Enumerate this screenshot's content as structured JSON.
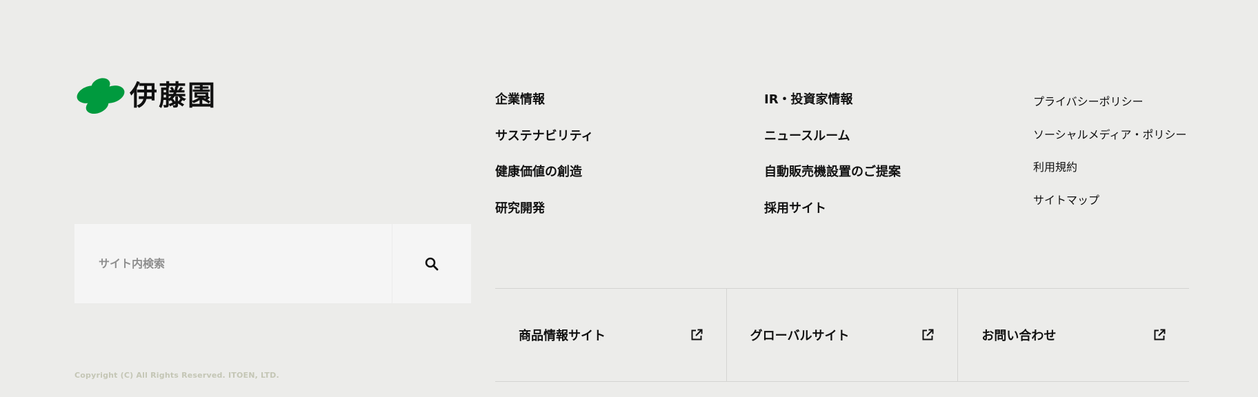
{
  "brand": {
    "name": "伊藤園",
    "logo_color": "#009a3e"
  },
  "search": {
    "placeholder": "サイト内検索",
    "icon": "search-icon"
  },
  "nav": {
    "col1": [
      "企業情報",
      "サステナビリティ",
      "健康価値の創造",
      "研究開発"
    ],
    "col2": [
      "IR・投資家情報",
      "ニュースルーム",
      "自動販売機設置のご提案",
      "採用サイト"
    ],
    "col3": [
      "プライバシーポリシー",
      "ソーシャルメディア・ポリシー",
      "利用規約",
      "サイトマップ"
    ]
  },
  "external_links": [
    {
      "label": "商品情報サイト",
      "icon": "external-link-icon"
    },
    {
      "label": "グローバルサイト",
      "icon": "external-link-icon"
    },
    {
      "label": "お問い合わせ",
      "icon": "external-link-icon"
    }
  ],
  "copyright": "Copyright (C) All Rights Reserved. ITOEN, LTD."
}
